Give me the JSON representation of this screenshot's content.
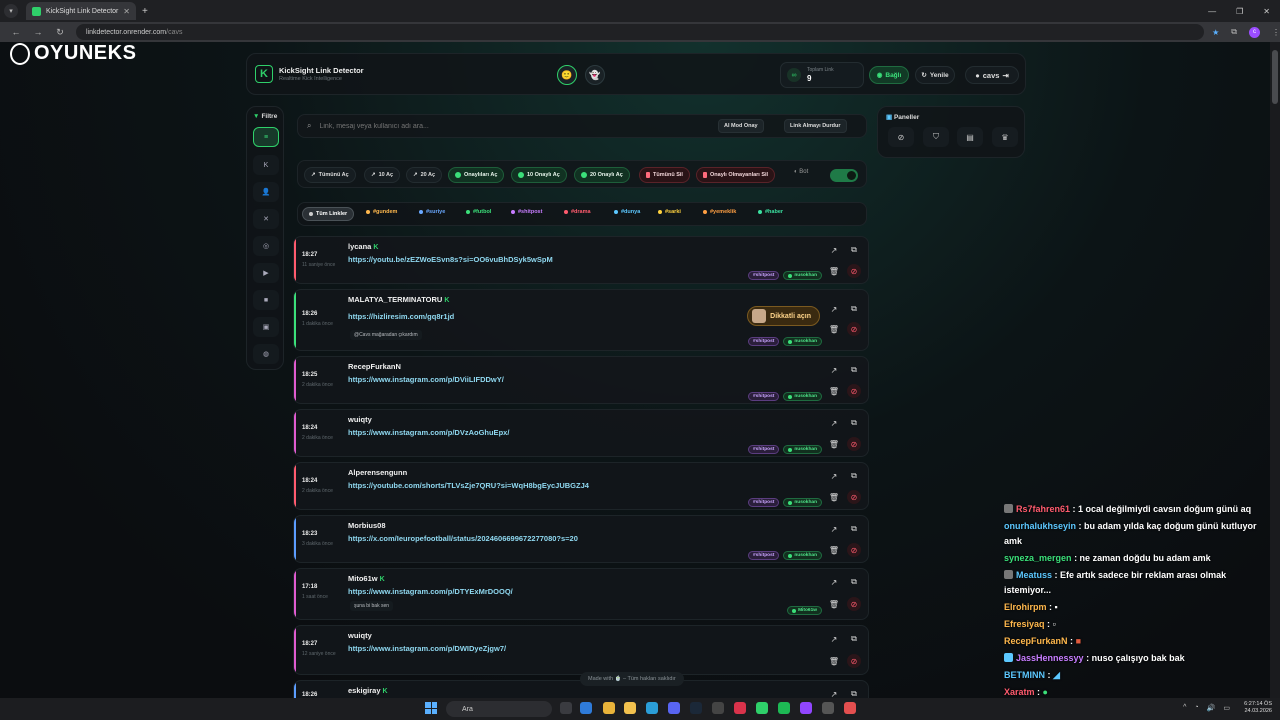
{
  "browser": {
    "tab_title": "KickSight Link Detector",
    "url_host": "linkdetector.onrender.com",
    "url_path": "/cavs",
    "profile_initial": "c"
  },
  "watermark": {
    "text": "OYUNEKS"
  },
  "header": {
    "brand_title": "KickSight Link Detector",
    "brand_subtitle": "Realtime Kick Intelligence",
    "total_label": "Toplam Link",
    "total_value": "9",
    "connected_label": "Bağlı",
    "refresh_label": "Yenile",
    "user_label": "cavs"
  },
  "sidebar": {
    "filter_label": "Filtre"
  },
  "search": {
    "placeholder": "Link, mesaj veya kullanıcı adı ara...",
    "ai_mod_label": "AI Mod Onay",
    "stop_label": "Link Almayı Durdur"
  },
  "actions": {
    "open_all": "Tümünü Aç",
    "open_10": "10 Aç",
    "open_20": "20 Aç",
    "open_approved": "Onaylıları Aç",
    "open_10_approved": "10 Onaylı Aç",
    "open_20_approved": "20 Onaylı Aç",
    "delete_all": "Tümünü Sil",
    "delete_unapproved": "Onaylı Olmayanları Sil",
    "bot_label": "Bot",
    "bot_enabled": true
  },
  "categories": [
    {
      "label": "Tüm Linkler",
      "color": "#cccccc"
    },
    {
      "label": "#gundem",
      "color": "#ffb84d"
    },
    {
      "label": "#suriye",
      "color": "#6aa8ff"
    },
    {
      "label": "#futbol",
      "color": "#3be07a"
    },
    {
      "label": "#shitpost",
      "color": "#c77dff"
    },
    {
      "label": "#drama",
      "color": "#ff5b6e"
    },
    {
      "label": "#dunya",
      "color": "#5cc8ff"
    },
    {
      "label": "#sarki",
      "color": "#ffd23f"
    },
    {
      "label": "#yemeklik",
      "color": "#ff9f43"
    },
    {
      "label": "#haber",
      "color": "#3be0a0"
    }
  ],
  "feed": [
    {
      "time": "18:27",
      "ago": "11 saniye önce",
      "user": "lycana",
      "verified": true,
      "link": "https://youtu.be/zEZWoESvn8s?si=OO6vuBhDSyk5wSpM",
      "note": "",
      "tags": [
        "#shitpost",
        "nusokhan"
      ],
      "bar": "#ff5b6e"
    },
    {
      "time": "18:26",
      "ago": "1 dakika önce",
      "user": "MALATYA_TERMINATORU",
      "verified": true,
      "link": "https://hizliresim.com/gq8r1jd",
      "note": "@Cavs mağaradan çıkardım",
      "tags": [
        "#shitpost",
        "nusokhan"
      ],
      "bar": "#3be07a",
      "warning": "Dikkatli açın"
    },
    {
      "time": "18:25",
      "ago": "2 dakika önce",
      "user": "RecepFurkanN",
      "verified": false,
      "link": "https://www.instagram.com/p/DViiLIFDDwY/",
      "note": "",
      "tags": [
        "#shitpost",
        "nusokhan"
      ],
      "bar": "#e05bd0"
    },
    {
      "time": "18:24",
      "ago": "2 dakika önce",
      "user": "wuiqty",
      "verified": false,
      "link": "https://www.instagram.com/p/DVzAoGhuEpx/",
      "note": "",
      "tags": [
        "#shitpost",
        "nusokhan"
      ],
      "bar": "#e05bd0"
    },
    {
      "time": "18:24",
      "ago": "2 dakika önce",
      "user": "Alperensengunn",
      "verified": false,
      "link": "https://youtube.com/shorts/TLVsZje7QRU?si=WqH8bgEycJUBGZJ4",
      "note": "",
      "tags": [
        "#shitpost",
        "nusokhan"
      ],
      "bar": "#ff5b6e"
    },
    {
      "time": "18:23",
      "ago": "3 dakika önce",
      "user": "Morbius08",
      "verified": false,
      "link": "https://x.com/Ieuropefootball/status/2024606699672277080?s=20",
      "note": "",
      "tags": [
        "#shitpost",
        "nusokhan"
      ],
      "bar": "#5c9dff"
    },
    {
      "time": "17:18",
      "ago": "1 saat önce",
      "user": "Mito61w",
      "verified": true,
      "link": "https://www.instagram.com/p/DTYExMrDOOQ/",
      "note": "şuna bi bak sen",
      "tags": [
        "Mito61w"
      ],
      "bar": "#e05bd0"
    },
    {
      "time": "18:27",
      "ago": "12 saniye önce",
      "user": "wuiqty",
      "verified": false,
      "link": "https://www.instagram.com/p/DWIDyeZjgw7/",
      "note": "",
      "tags": [],
      "bar": "#e05bd0"
    },
    {
      "time": "18:26",
      "ago": "",
      "user": "eskigiray",
      "verified": true,
      "link": "",
      "note": "",
      "tags": [],
      "bar": "#5c9dff"
    }
  ],
  "panels": {
    "label": "Paneller"
  },
  "footer": {
    "made_with": "Made with 🍵 – Tüm hakları saklıdır"
  },
  "chat": [
    {
      "user": "Rs7fahren61",
      "color": "#ff5b6e",
      "text": ": 1 ocal değilmiydi cavsın doğum günü aq",
      "badge": true
    },
    {
      "user": "onurhalukhseyin",
      "color": "#5cc8ff",
      "text": ": bu adam yılda kaç doğum günü kutluyor amk",
      "badge": false
    },
    {
      "user": "syneza_mergen",
      "color": "#3be07a",
      "text": ": ne zaman doğdu bu adam amk",
      "badge": false
    },
    {
      "user": "Meatuss",
      "color": "#5cc8ff",
      "text": ": Efe artık sadece bir reklam arası olmak istemiyor...",
      "badge": true
    },
    {
      "user": "Elrohirpm",
      "color": "#ffb84d",
      "text": ":",
      "badge": false
    },
    {
      "user": "Efresiyaq",
      "color": "#ffb84d",
      "text": ":",
      "badge": false
    },
    {
      "user": "RecepFurkanN",
      "color": "#ffb84d",
      "text": ":",
      "badge": false
    },
    {
      "user": "JassHennessyy",
      "color": "#c77dff",
      "text": ": nuso çalışıyo bak bak",
      "badge": true
    },
    {
      "user": "BETMINN",
      "color": "#5cc8ff",
      "text": ":",
      "badge": false
    },
    {
      "user": "Xaratm",
      "color": "#ff5b6e",
      "text": ":",
      "badge": false
    }
  ],
  "taskbar": {
    "search": "Ara",
    "time": "6:27:14 ÖS",
    "date": "24.03.2026"
  }
}
